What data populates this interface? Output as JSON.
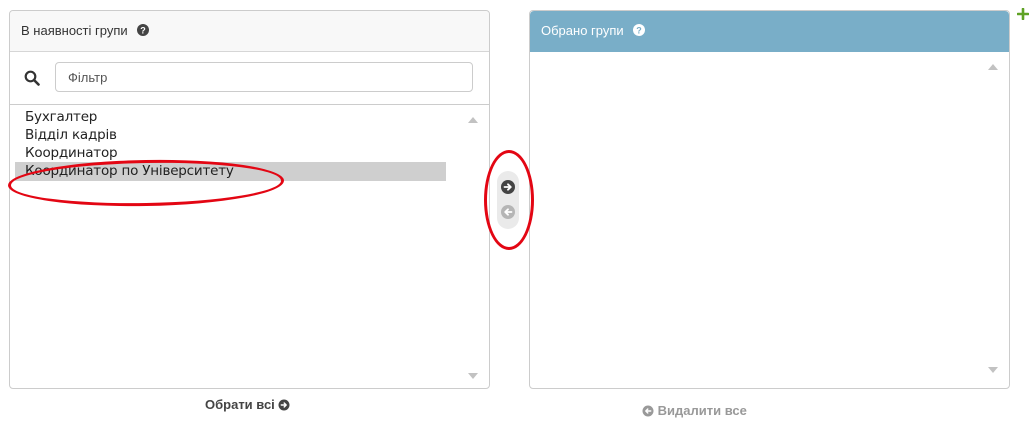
{
  "available": {
    "title": "В наявності групи",
    "filter": {
      "placeholder": "Фільтр",
      "value": ""
    },
    "options": [
      {
        "label": "Бухгалтер",
        "selected": false
      },
      {
        "label": "Відділ кадрів",
        "selected": false
      },
      {
        "label": "Координатор",
        "selected": false
      },
      {
        "label": "Координатор по Університету",
        "selected": true
      }
    ],
    "choose_all": "Обрати всі"
  },
  "chosen": {
    "title": "Обрано групи",
    "remove_all": "Видалити все"
  },
  "icons": {
    "help": "question-circle-icon",
    "filter": "search-icon",
    "add": "arrow-right-circle-icon",
    "remove": "arrow-left-circle-icon",
    "add_related": "plus-icon"
  },
  "colors": {
    "chosen_header": "#79aec8",
    "selected_row": "#cfcfcf",
    "annotation": "#e30613",
    "add_related": "#5fa225"
  }
}
